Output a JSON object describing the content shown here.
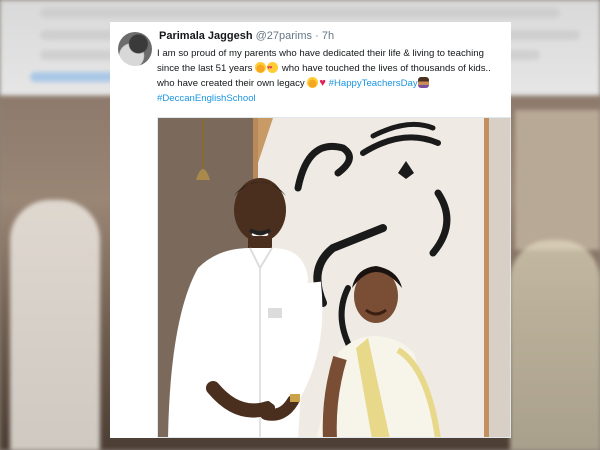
{
  "tweet": {
    "display_name": "Parimala Jaggesh",
    "handle": "@27parims",
    "separator": "·",
    "time": "7h",
    "line1": "I am so proud of my parents who have dedicated their life & living to teaching",
    "line2a": "since the last 51 years",
    "line2b": "who have touched the lives of thousands of kids..",
    "line3a": "who have created their own legacy",
    "hashtag1": "#HappyTeachersDay",
    "hashtag2": "#DeccanEnglishSchool"
  },
  "icons": {
    "avatar": "avatar",
    "emoji1": "smiling-face-icon",
    "emoji2": "heart-eyes-icon",
    "emoji3": "smiling-face-icon",
    "emoji4": "red-heart-icon",
    "emoji5": "teacher-icon"
  },
  "colors": {
    "hashtag": "#1b95e0",
    "handle": "#657786",
    "text": "#14171a"
  }
}
